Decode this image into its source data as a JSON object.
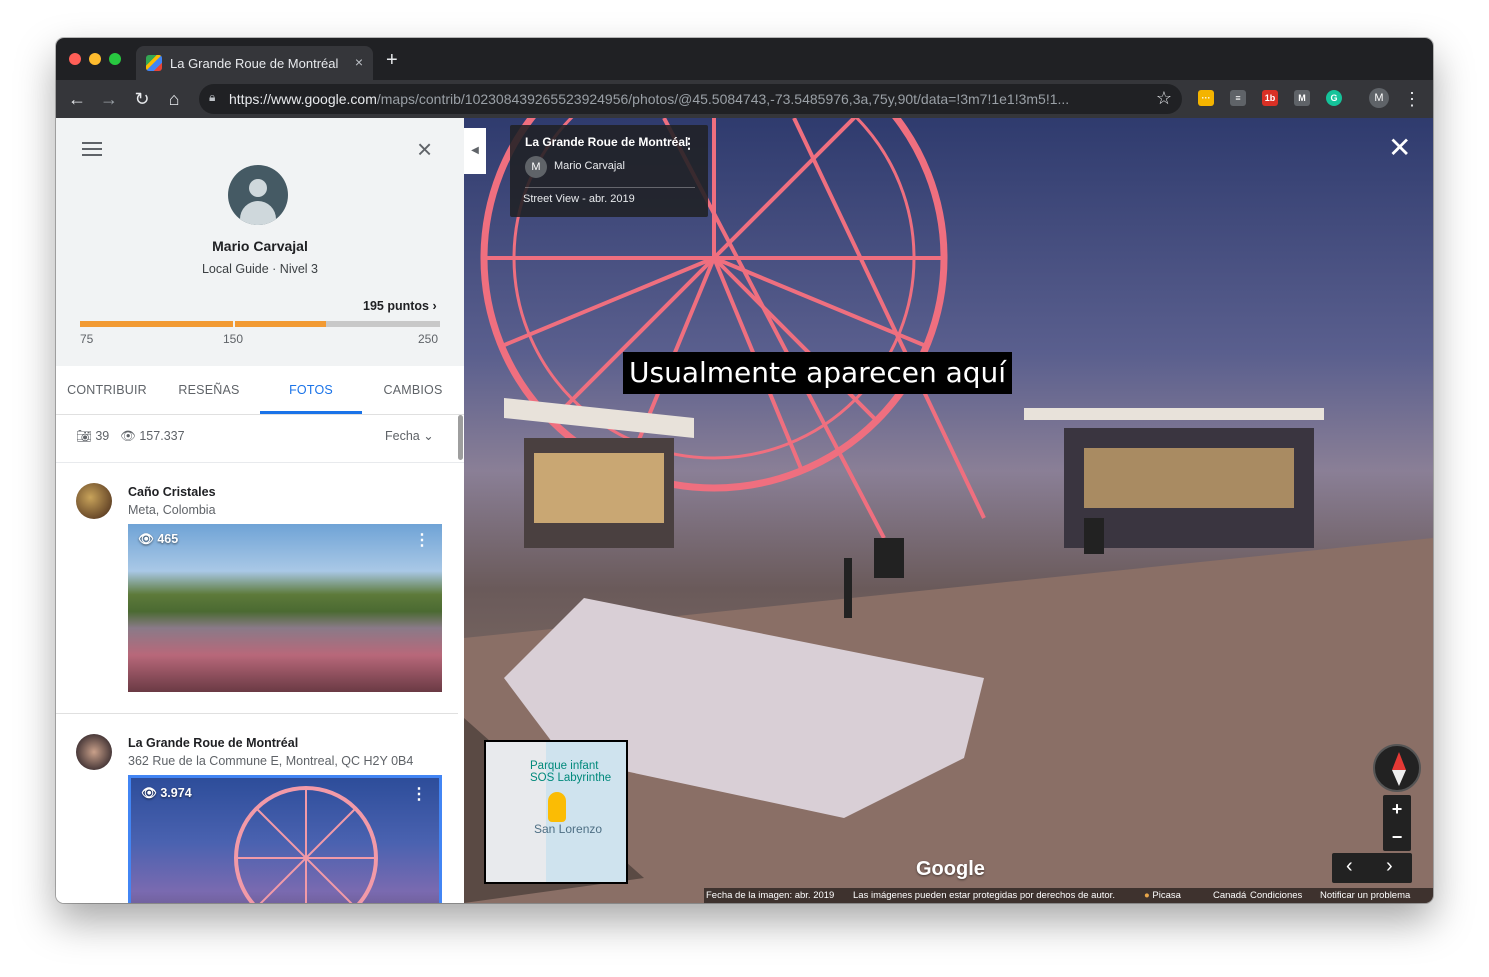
{
  "browser": {
    "tab_title": "La Grande Roue de Montréal -",
    "tab_close": "×",
    "new_tab": "+",
    "url_scheme": "https://",
    "url_host": "www.google.com",
    "url_path": "/maps/contrib/102308439265523924956/photos/@45.5084743,-73.5485976,3a,75y,90t/data=!3m7!1e1!3m5!1...",
    "profile_initial": "M",
    "extensions": [
      {
        "label": "···",
        "color": "#f4b400"
      },
      {
        "label": "≡",
        "color": "#5f6368"
      },
      {
        "label": "1b",
        "color": "#d93025"
      },
      {
        "label": "M",
        "color": "#5f6368"
      },
      {
        "label": "G",
        "color": "#15c39a"
      }
    ]
  },
  "profile": {
    "name": "Mario Carvajal",
    "level": "Local Guide · Nivel 3",
    "points": "195 puntos ›",
    "progress_fraction": 0.683,
    "tick_labels": [
      "75",
      "150",
      "250"
    ]
  },
  "tabs": [
    "CONTRIBUIR",
    "RESEÑAS",
    "FOTOS",
    "CAMBIOS"
  ],
  "active_tab": "FOTOS",
  "stats": {
    "photos": "39",
    "views": "157.337",
    "sort": "Fecha"
  },
  "photos": [
    {
      "name": "Caño Cristales",
      "address": "Meta, Colombia",
      "views": "465",
      "more": "⋮"
    },
    {
      "name": "La Grande Roue de Montréal",
      "address": "362 Rue de la Commune E, Montreal, QC H2Y 0B4",
      "views": "3.974",
      "more": "⋮"
    }
  ],
  "streetview": {
    "card_title": "La Grande Roue de Montréal",
    "card_author_initial": "M",
    "card_author": "Mario Carvajal",
    "card_date": "Street View - abr. 2019",
    "annotation": "Usualmente aparecen aquí",
    "minimap_poi": "Parque infant\nSOS Labyrinthe",
    "minimap_water": "San Lorenzo",
    "logo": "Google",
    "footer": {
      "date": "Fecha de la imagen: abr. 2019",
      "copyright": "Las imágenes pueden estar protegidas por derechos de autor.",
      "picasa": "Picasa",
      "country": "Canadá",
      "terms": "Condiciones",
      "report": "Notificar un problema"
    }
  }
}
